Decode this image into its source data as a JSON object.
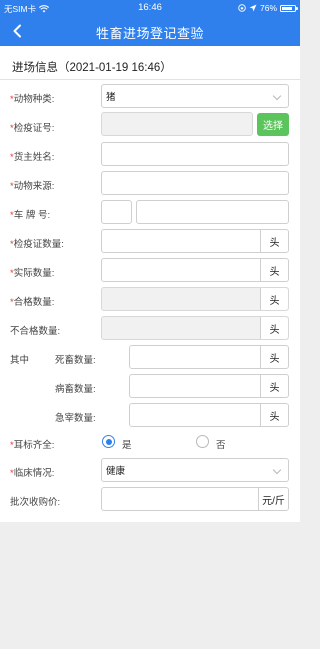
{
  "status_bar": {
    "carrier": "无SIM卡",
    "time": "16:46",
    "battery": "76%"
  },
  "nav": {
    "title": "牲畜进场登记查验"
  },
  "section": {
    "title": "进场信息（2021-01-19 16:46）"
  },
  "form": {
    "animal_type": {
      "label": "动物种类:",
      "value": "猪"
    },
    "quarantine_cert_no": {
      "label": "检疫证号:",
      "value": "",
      "select_button": "选择"
    },
    "owner_name": {
      "label": "货主姓名:",
      "value": ""
    },
    "animal_source": {
      "label": "动物来源:",
      "value": ""
    },
    "plate_no": {
      "label": "车 牌 号:",
      "prefix_value": "",
      "number_value": ""
    },
    "cert_quantity": {
      "label": "检疫证数量:",
      "value": "",
      "unit": "头"
    },
    "actual_quantity": {
      "label": "实际数量:",
      "value": "",
      "unit": "头"
    },
    "qualified_quantity": {
      "label": "合格数量:",
      "value": "",
      "unit": "头"
    },
    "unqualified_quantity": {
      "label": "不合格数量:",
      "value": "",
      "unit": "头"
    },
    "breakdown": {
      "group_label": "其中",
      "dead": {
        "label": "死畜数量:",
        "value": "",
        "unit": "头"
      },
      "sick": {
        "label": "病畜数量:",
        "value": "",
        "unit": "头"
      },
      "emergency": {
        "label": "急宰数量:",
        "value": "",
        "unit": "头"
      }
    },
    "ear_tag_complete": {
      "label": "耳标齐全:",
      "options": [
        "是",
        "否"
      ],
      "selected": "是"
    },
    "clinical_status": {
      "label": "临床情况:",
      "value": "健康"
    },
    "purchase_price": {
      "label": "批次收购价:",
      "value": "",
      "unit": "元/斤"
    }
  },
  "colors": {
    "primary": "#2f80ed",
    "select_button": "#5cc45c",
    "required": "#e53935"
  }
}
